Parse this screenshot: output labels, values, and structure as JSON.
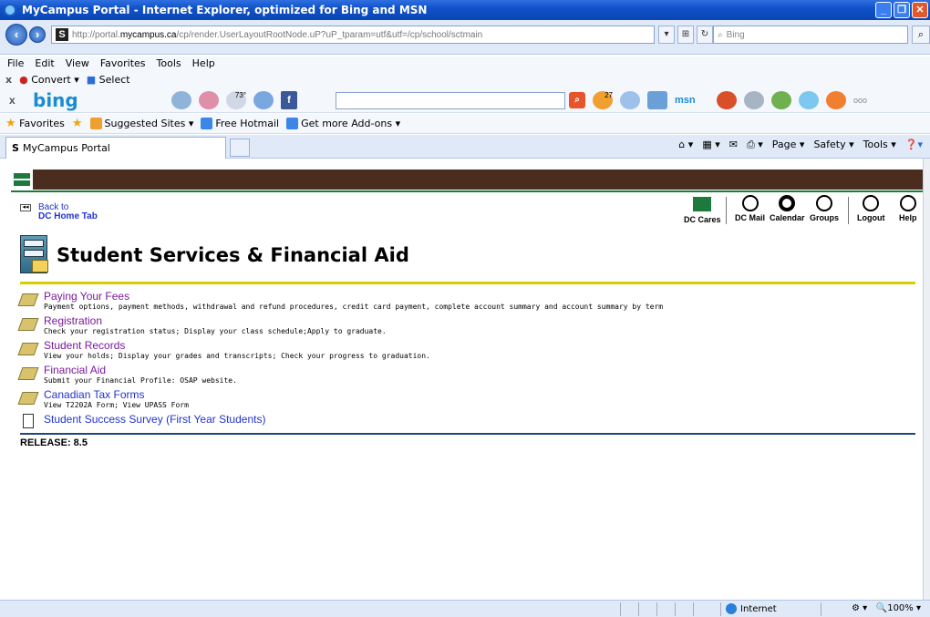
{
  "window": {
    "title": "MyCampus Portal - Internet Explorer, optimized for Bing and MSN"
  },
  "addressbar": {
    "url_prefix": "http://portal.",
    "url_domain": "mycampus.ca",
    "url_rest": "/cp/render.UserLayoutRootNode.uP?uP_tparam=utf&utf=/cp/school/sctmain",
    "search_placeholder": "Bing"
  },
  "menubar": {
    "items": [
      "File",
      "Edit",
      "View",
      "Favorites",
      "Tools",
      "Help"
    ]
  },
  "convertbar": {
    "convert": "Convert",
    "select": "Select"
  },
  "bingbar": {
    "logo": "bing",
    "weather": "73°",
    "count": "27",
    "more": "ooo"
  },
  "favorites": {
    "label": "Favorites",
    "items": [
      "Suggested Sites ▾",
      "Free Hotmail",
      "Get more Add-ons ▾"
    ]
  },
  "tabs": {
    "active": "MyCampus Portal"
  },
  "commandbar": {
    "items": [
      "Page ▾",
      "Safety ▾",
      "Tools ▾"
    ]
  },
  "back": {
    "line1": "Back to",
    "line2": "DC Home Tab"
  },
  "tools": [
    "DC Cares",
    "DC Mail",
    "Calendar",
    "Groups",
    "Logout",
    "Help"
  ],
  "section": {
    "title": "Student Services & Financial Aid"
  },
  "items": [
    {
      "title": "Paying Your Fees",
      "desc": "Payment options, payment methods, withdrawal and refund procedures, credit card payment, complete account summary and account summary by term",
      "visited": true
    },
    {
      "title": "Registration",
      "desc": "Check your registration status; Display your class schedule;Apply to graduate.",
      "visited": true
    },
    {
      "title": "Student Records",
      "desc": "View your holds; Display your grades and transcripts; Check your progress to graduation.",
      "visited": true
    },
    {
      "title": "Financial Aid",
      "desc": "Submit your Financial Profile: OSAP website.",
      "visited": true
    },
    {
      "title": "Canadian Tax Forms",
      "desc": "View T2202A Form; View UPASS Form",
      "visited": false
    },
    {
      "title": "Student Success Survey (First Year Students)",
      "desc": "",
      "visited": false
    }
  ],
  "release": "RELEASE: 8.5",
  "statusbar": {
    "zone": "Internet",
    "zoom": "100%"
  }
}
